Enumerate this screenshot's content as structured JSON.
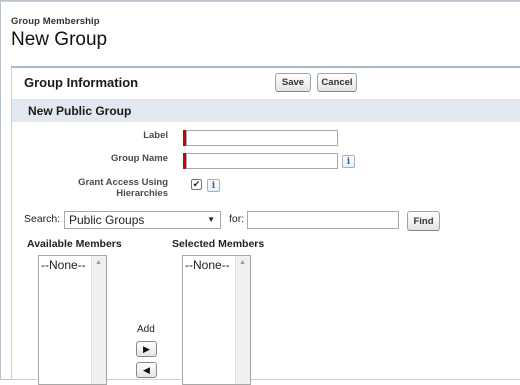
{
  "header": {
    "breadcrumb": "Group Membership",
    "title": "New Group"
  },
  "panel": {
    "title": "Group Information",
    "save_label": "Save",
    "cancel_label": "Cancel",
    "section_title": "New Public Group"
  },
  "form": {
    "label_field": {
      "label": "Label",
      "value": "",
      "required": true
    },
    "group_name_field": {
      "label": "Group Name",
      "value": "",
      "required": true
    },
    "grant_access": {
      "label_line1": "Grant Access Using",
      "label_line2": "Hierarchies",
      "checked": true,
      "check_glyph": "✔"
    },
    "info_glyph": "i"
  },
  "search": {
    "label": "Search:",
    "selected": "Public Groups",
    "for_label": "for:",
    "query": "",
    "find_label": "Find"
  },
  "members": {
    "available_label": "Available Members",
    "available_options": [
      "--None--"
    ],
    "selected_label": "Selected Members",
    "selected_options": [
      "--None--"
    ],
    "add_label": "Add",
    "add_arrow": "▶",
    "remove_arrow": "◀"
  }
}
